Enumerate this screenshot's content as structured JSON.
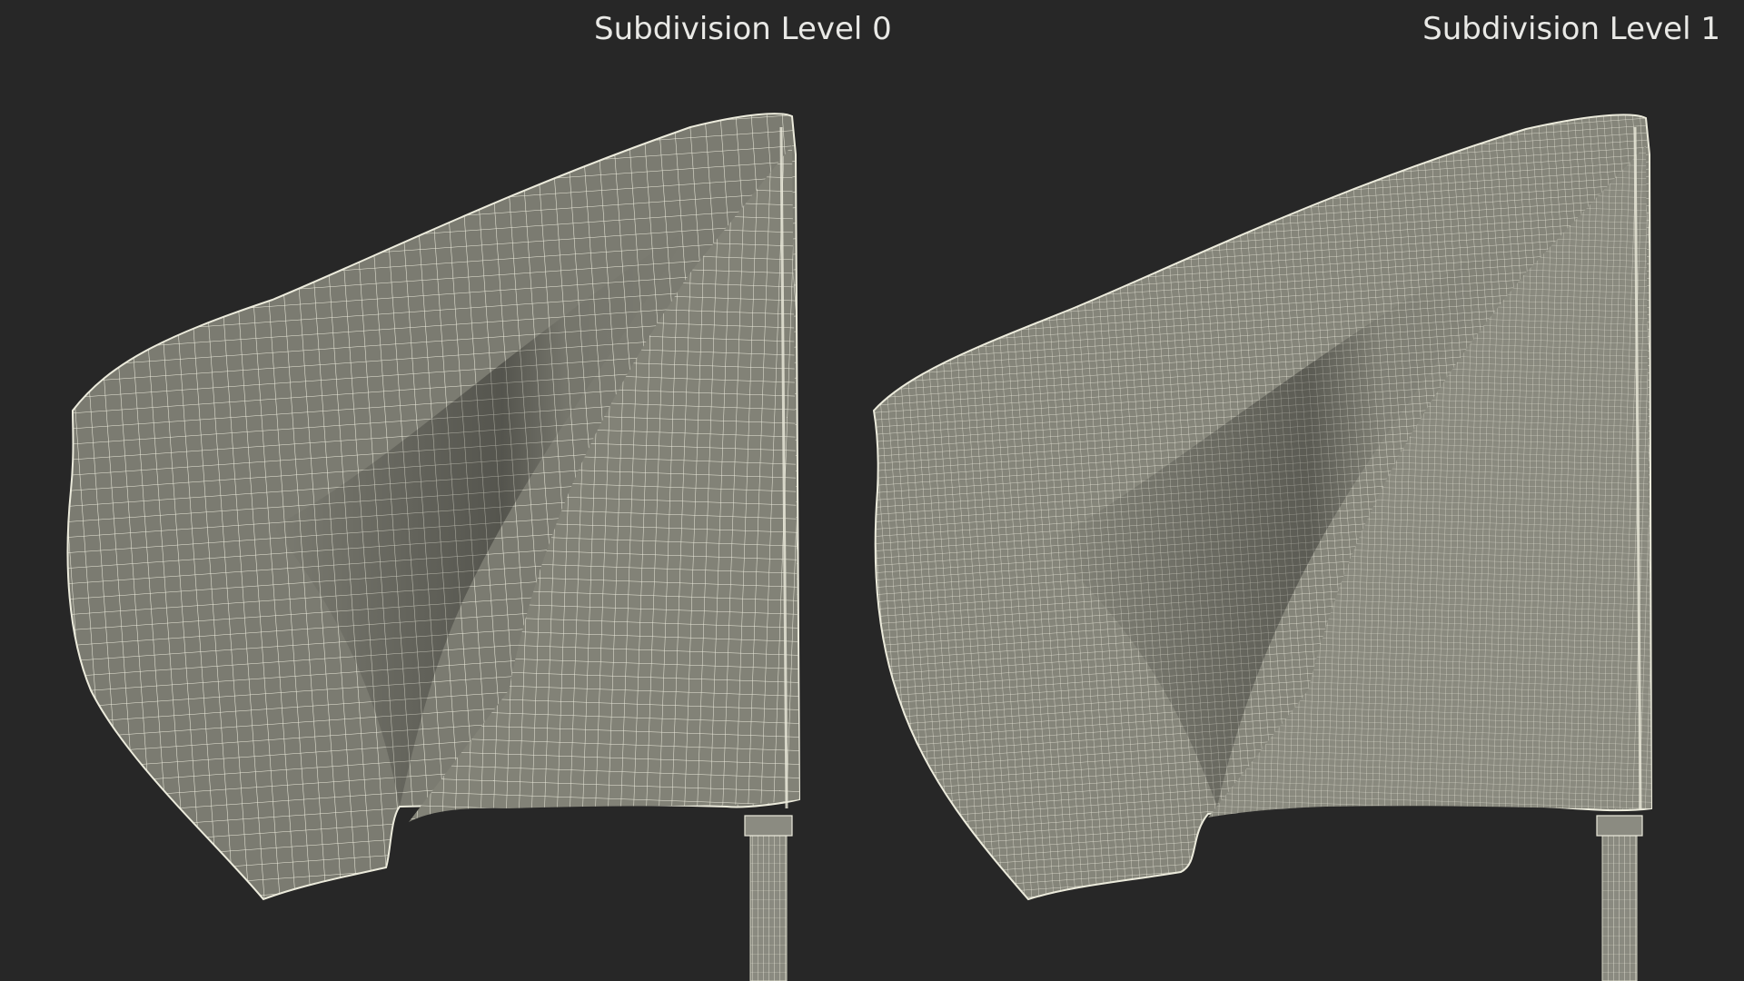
{
  "labels": {
    "left": "Subdivision Level 0",
    "right": "Subdivision Level 1"
  },
  "colors": {
    "background": "#272727",
    "cloth": "#7a7a70",
    "wire": "#eeeedd",
    "label": "#e9e9e6"
  },
  "panels": [
    {
      "name": "subdivision-level-0",
      "wire_density": "coarse"
    },
    {
      "name": "subdivision-level-1",
      "wire_density": "fine"
    }
  ]
}
